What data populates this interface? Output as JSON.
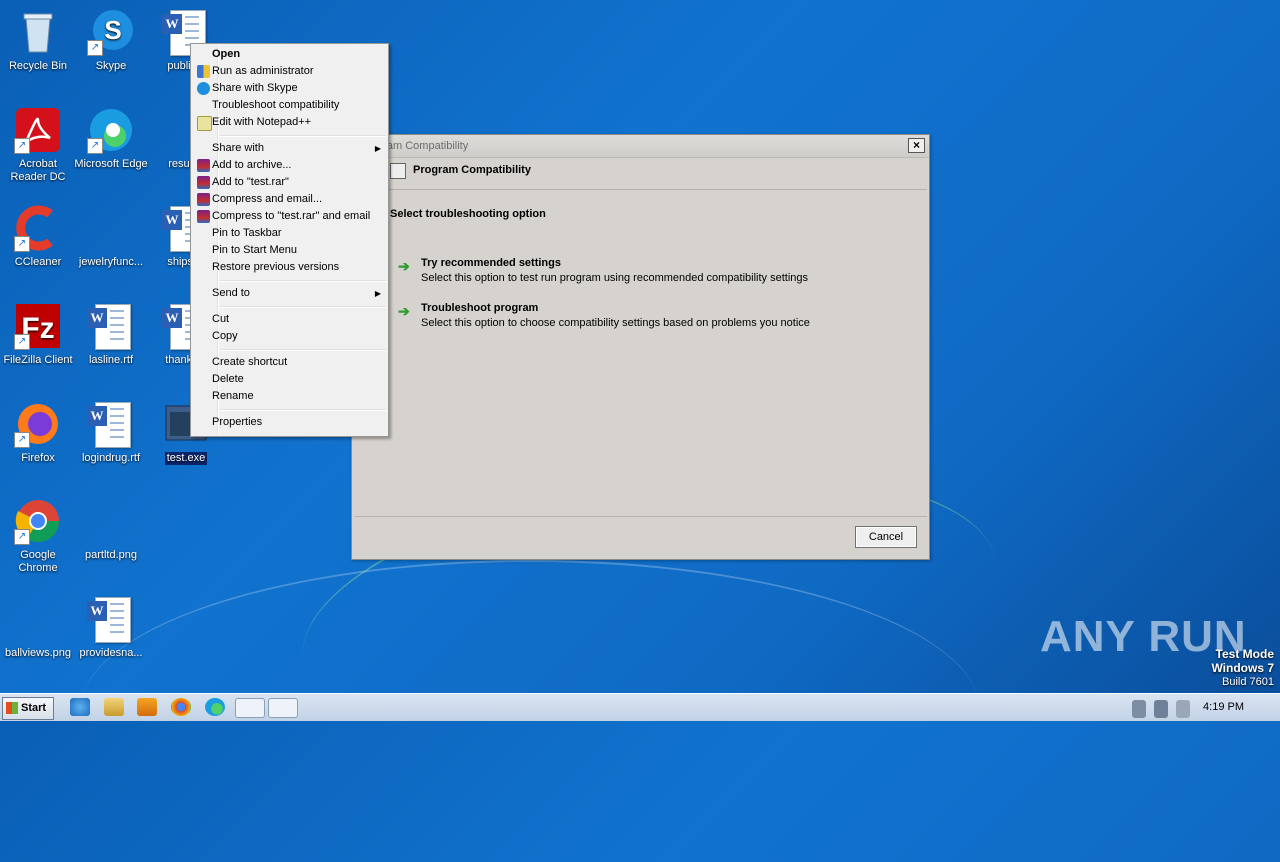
{
  "desktop_icons": [
    {
      "label": "Recycle Bin"
    },
    {
      "label": "Skype"
    },
    {
      "label": "publishi"
    },
    {
      "label": "Acrobat Reader DC"
    },
    {
      "label": "Microsoft Edge"
    },
    {
      "label": "resultgi"
    },
    {
      "label": "CCleaner"
    },
    {
      "label": "jewelryfunc..."
    },
    {
      "label": "shipsco"
    },
    {
      "label": "FileZilla Client"
    },
    {
      "label": "lasline.rtf"
    },
    {
      "label": "thankpla"
    },
    {
      "label": "Firefox"
    },
    {
      "label": "logindrug.rtf"
    },
    {
      "label": "test.exe"
    },
    {
      "label": "Google Chrome"
    },
    {
      "label": "partltd.png"
    },
    {
      "label": "ballviews.png"
    },
    {
      "label": "providesna..."
    }
  ],
  "context_menu": {
    "items": [
      {
        "label": "Open"
      },
      {
        "label": "Run as administrator"
      },
      {
        "label": "Share with Skype"
      },
      {
        "label": "Troubleshoot compatibility"
      },
      {
        "label": "Edit with Notepad++"
      },
      {
        "label": "Share with"
      },
      {
        "label": "Add to archive..."
      },
      {
        "label": "Add to \"test.rar\""
      },
      {
        "label": "Compress and email..."
      },
      {
        "label": "Compress to \"test.rar\" and email"
      },
      {
        "label": "Pin to Taskbar"
      },
      {
        "label": "Pin to Start Menu"
      },
      {
        "label": "Restore previous versions"
      },
      {
        "label": "Send to"
      },
      {
        "label": "Cut"
      },
      {
        "label": "Copy"
      },
      {
        "label": "Create shortcut"
      },
      {
        "label": "Delete"
      },
      {
        "label": "Rename"
      },
      {
        "label": "Properties"
      }
    ]
  },
  "dialog": {
    "title": "Program Compatibility",
    "header": "Program Compatibility",
    "question": "Select troubleshooting option",
    "options": [
      {
        "heading": "Try recommended settings",
        "description": "Select this option to test run program using recommended compatibility settings"
      },
      {
        "heading": "Troubleshoot program",
        "description": "Select this option to choose compatibility settings based on problems you notice"
      }
    ],
    "cancel_label": "Cancel"
  },
  "taskbar": {
    "start_label": "Start",
    "clock": "4:19 PM"
  },
  "watermark": {
    "brand": "ANY RUN",
    "line1": "Test Mode",
    "line2": "Windows 7",
    "line3": "Build 7601"
  }
}
